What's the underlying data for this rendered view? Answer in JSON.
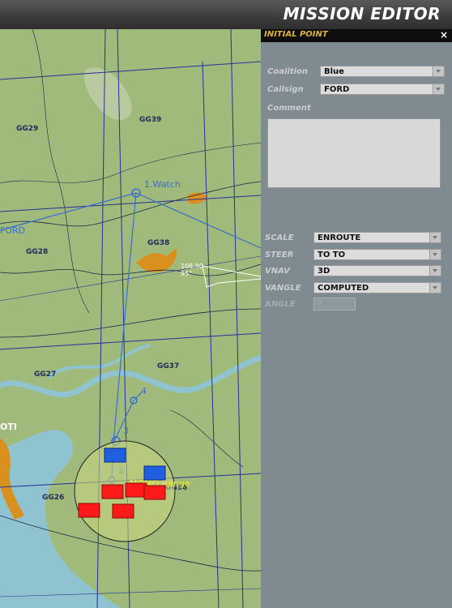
{
  "window": {
    "title": "MISSION EDITOR"
  },
  "panel": {
    "title": "INITIAL POINT",
    "close_label": "×",
    "coalition": {
      "label": "Coalition",
      "value": "Blue"
    },
    "callsign": {
      "label": "Callsign",
      "value": "FORD"
    },
    "comment": {
      "label": "Comment",
      "value": ""
    },
    "scale": {
      "label": "SCALE",
      "value": "ENROUTE"
    },
    "steer": {
      "label": "STEER",
      "value": "TO TO"
    },
    "vnav": {
      "label": "VNAV",
      "value": "3D"
    },
    "vangle": {
      "label": "VANGLE",
      "value": "COMPUTED"
    },
    "angle": {
      "label": "ANGLE",
      "value": "0"
    }
  },
  "map": {
    "grid_labels": [
      "GG29",
      "GG39",
      "GG28",
      "GG38",
      "GG27",
      "GG37",
      "GG26",
      "GG36"
    ],
    "waypoints": {
      "watch": "1.Watch",
      "wp2": "2",
      "wp3": "3",
      "wp4": "4"
    },
    "callsign_label": "FORD",
    "range_label": "MOMO Range",
    "town_label": "OTI",
    "heading_info": [
      "108.90",
      "95°"
    ],
    "colors": {
      "land": "#9fba7a",
      "water": "#8fc3cf",
      "grid": "#23309a",
      "route": "#3a6fd0",
      "red_unit": "#ff1a1a",
      "blue_unit": "#1f5fe0",
      "range": "#e8e64a",
      "panel": "#7f8a91",
      "panel_header": "#0e0e0e",
      "panel_header_text": "#e0b33a"
    }
  }
}
